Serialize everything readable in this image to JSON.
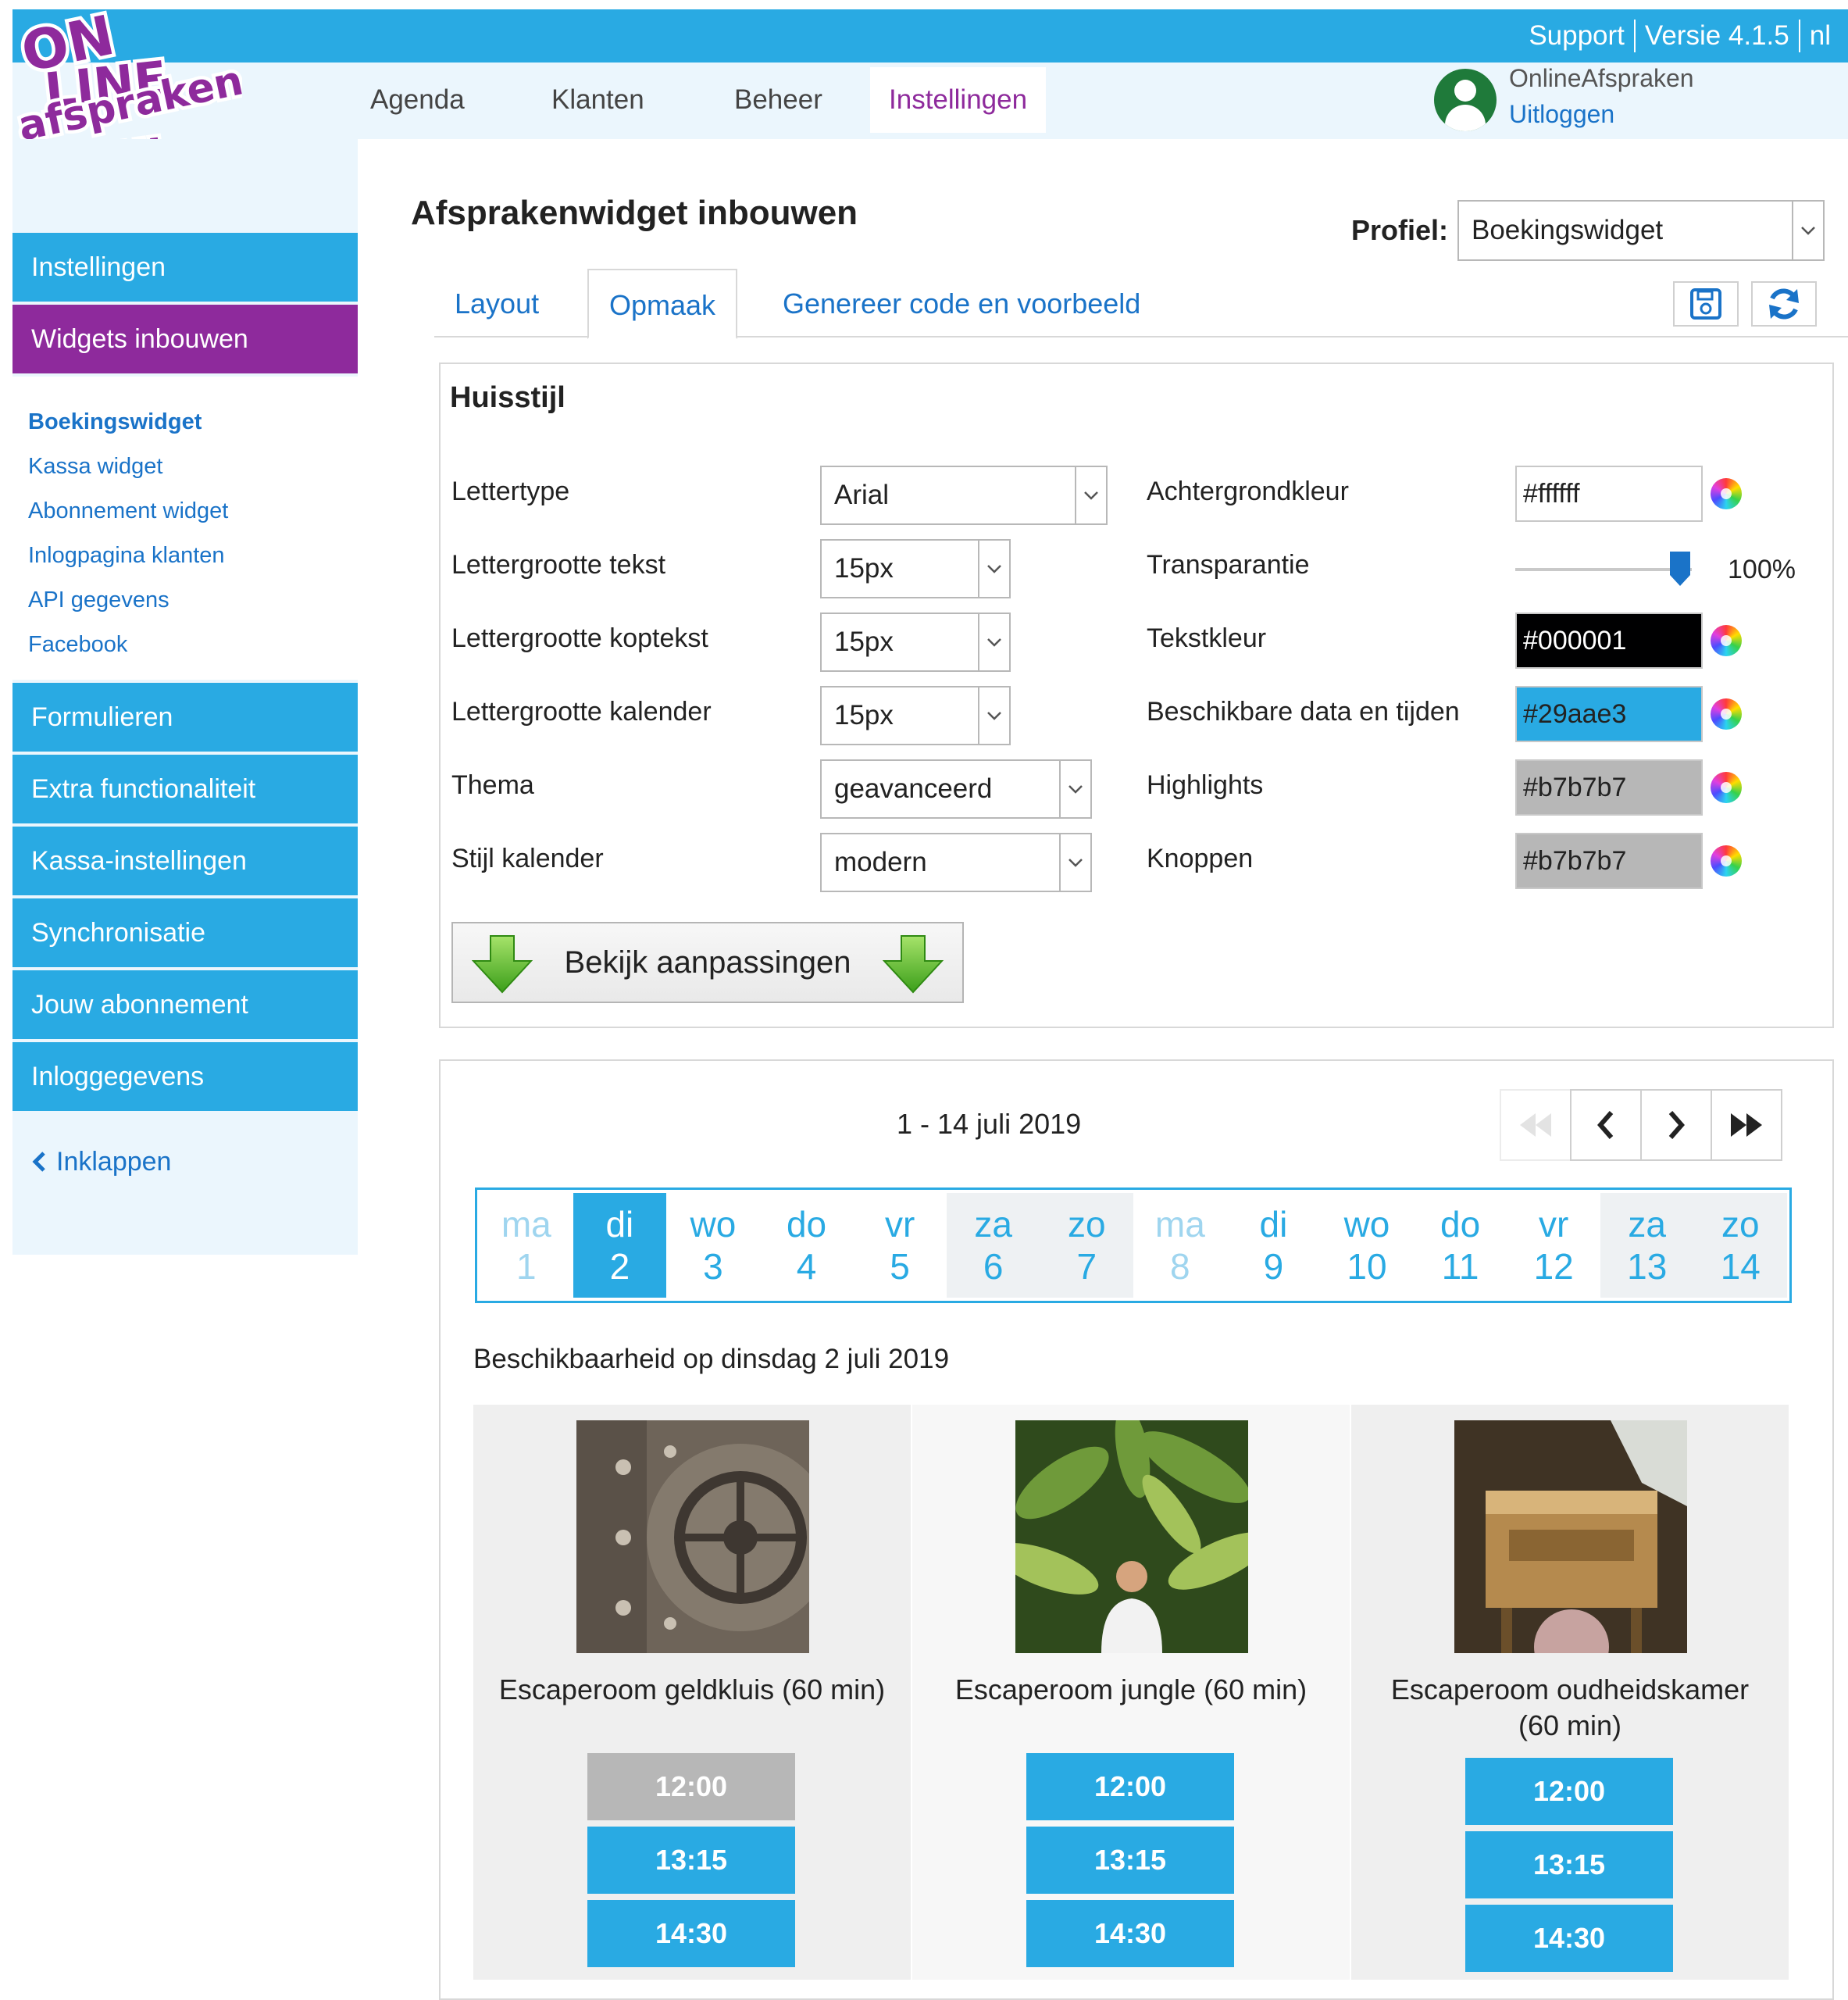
{
  "toplinks": {
    "support": "Support",
    "version": "Versie 4.1.5",
    "lang": "nl"
  },
  "logo": {
    "line1": "ON",
    "line2": "LINE",
    "line3": "afspraken",
    "line4": ".NL"
  },
  "nav": {
    "agenda": "Agenda",
    "klanten": "Klanten",
    "beheer": "Beheer",
    "instellingen": "Instellingen"
  },
  "user": {
    "name": "OnlineAfspraken",
    "logout": "Uitloggen"
  },
  "sidebar": {
    "instellingen": "Instellingen",
    "widgets": "Widgets inbouwen",
    "sub": [
      "Boekingswidget",
      "Kassa widget",
      "Abonnement widget",
      "Inlogpagina klanten",
      "API gegevens",
      "Facebook"
    ],
    "formulieren": "Formulieren",
    "extra": "Extra functionaliteit",
    "kassa": "Kassa-instellingen",
    "sync": "Synchronisatie",
    "abonnement": "Jouw abonnement",
    "inlog": "Inloggegevens",
    "collapse": "Inklappen"
  },
  "page": {
    "title": "Afsprakenwidget inbouwen",
    "profile_label": "Profiel:",
    "profile_value": "Boekingswidget"
  },
  "tabs": {
    "layout": "Layout",
    "opmaak": "Opmaak",
    "genereer": "Genereer code en voorbeeld"
  },
  "huisstijl": {
    "title": "Huisstijl",
    "lettertype_label": "Lettertype",
    "lettertype_value": "Arial",
    "lg_tekst_label": "Lettergrootte tekst",
    "lg_tekst_value": "15px",
    "lg_kop_label": "Lettergrootte koptekst",
    "lg_kop_value": "15px",
    "lg_kal_label": "Lettergrootte kalender",
    "lg_kal_value": "15px",
    "thema_label": "Thema",
    "thema_value": "geavanceerd",
    "stijl_label": "Stijl kalender",
    "stijl_value": "modern",
    "achtergrond_label": "Achtergrondkleur",
    "achtergrond_value": "#ffffff",
    "transparantie_label": "Transparantie",
    "transparantie_value": "100%",
    "transparantie_level": 1.0,
    "tekstkleur_label": "Tekstkleur",
    "tekstkleur_value": "#000001",
    "beschikbaar_label": "Beschikbare data en tijden",
    "beschikbaar_value": "#29aae3",
    "highlights_label": "Highlights",
    "highlights_value": "#b7b7b7",
    "knoppen_label": "Knoppen",
    "knoppen_value": "#b7b7b7",
    "preview_button": "Bekijk aanpassingen"
  },
  "calendar": {
    "range": "1 - 14 juli 2019",
    "days": [
      {
        "name": "ma",
        "num": "1"
      },
      {
        "name": "di",
        "num": "2"
      },
      {
        "name": "wo",
        "num": "3"
      },
      {
        "name": "do",
        "num": "4"
      },
      {
        "name": "vr",
        "num": "5"
      },
      {
        "name": "za",
        "num": "6"
      },
      {
        "name": "zo",
        "num": "7"
      },
      {
        "name": "ma",
        "num": "8"
      },
      {
        "name": "di",
        "num": "9"
      },
      {
        "name": "wo",
        "num": "10"
      },
      {
        "name": "do",
        "num": "11"
      },
      {
        "name": "vr",
        "num": "12"
      },
      {
        "name": "za",
        "num": "13"
      },
      {
        "name": "zo",
        "num": "14"
      }
    ],
    "availability": "Beschikbaarheid op dinsdag 2 juli 2019"
  },
  "rooms": [
    {
      "name": "Escaperoom geldkluis (60 min)",
      "slots": [
        "12:00",
        "13:15",
        "14:30"
      ]
    },
    {
      "name": "Escaperoom jungle (60 min)",
      "slots": [
        "12:00",
        "13:15",
        "14:30"
      ]
    },
    {
      "name": "Escaperoom oudheidskamer (60 min)",
      "slots": [
        "12:00",
        "13:15",
        "14:30"
      ]
    }
  ],
  "colors": {
    "primary": "#29aae3",
    "brand_purple": "#8e2a9c",
    "highlight_grey": "#b7b7b7",
    "text": "#000001",
    "background": "#ffffff"
  },
  "icons": [
    "logo",
    "user-avatar-icon",
    "chevron-down-icon",
    "save-icon",
    "refresh-icon",
    "color-wheel-icon",
    "green-down-arrow-icon",
    "first-page-icon",
    "prev-icon",
    "next-icon",
    "last-page-icon",
    "chevron-left-icon"
  ]
}
